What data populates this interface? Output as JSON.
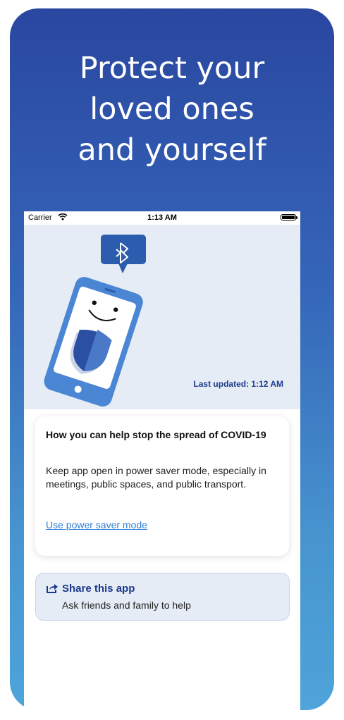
{
  "headline": [
    "Protect your",
    "loved ones",
    "and yourself"
  ],
  "status_bar": {
    "carrier": "Carrier",
    "time": "1:13 AM"
  },
  "hero": {
    "last_updated": "Last updated: 1:12 AM"
  },
  "card": {
    "title": "How you can help stop the spread of COVID-19",
    "body": "Keep app open in power saver mode, especially in meetings, public spaces, and public transport.",
    "link": "Use power saver mode"
  },
  "share": {
    "title": "Share this app",
    "subtitle": "Ask friends and family to help"
  },
  "colors": {
    "brand_dark": "#1b3a8c",
    "link": "#2f7fd4",
    "hero_bg": "#e6ecf6",
    "gradient_top": "#2a47a0",
    "gradient_bottom": "#4ea4db"
  },
  "icons": [
    "wifi-icon",
    "battery-icon",
    "bluetooth-icon",
    "phone-illustration",
    "shield-icon",
    "share-icon"
  ]
}
